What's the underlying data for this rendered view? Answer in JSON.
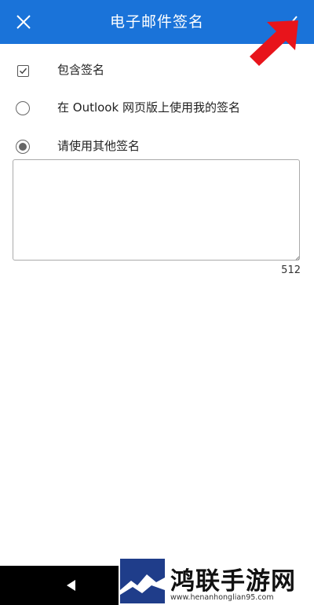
{
  "header": {
    "title": "电子邮件签名",
    "close_icon": "close-icon",
    "confirm_icon": "checkmark-icon",
    "bg_color": "#1a73d9"
  },
  "options": {
    "include_signature": {
      "label": "包含签名",
      "checked": true
    },
    "use_outlook_web": {
      "label": "在 Outlook 网页版上使用我的签名",
      "selected": false
    },
    "use_other": {
      "label": "请使用其他签名",
      "selected": true
    }
  },
  "signature": {
    "value": "",
    "char_count": "512"
  },
  "navbar": {
    "back_icon": "back-triangle-icon"
  },
  "watermark": {
    "title": "鸿联手游网",
    "url": "www.henanhonglian95.com"
  }
}
